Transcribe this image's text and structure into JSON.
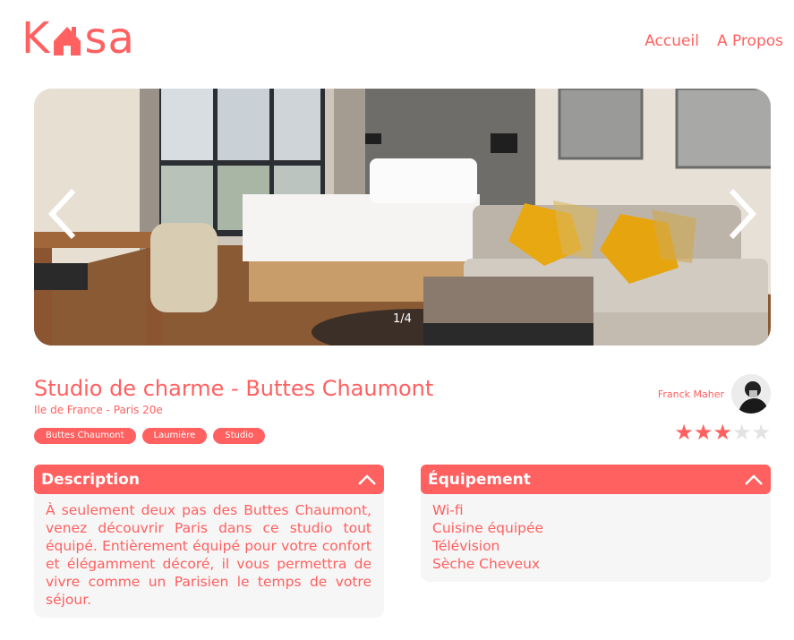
{
  "header": {
    "logo": {
      "text_start": "K",
      "text_end": "sa",
      "icon": "house-icon"
    },
    "nav": [
      {
        "label": "Accueil"
      },
      {
        "label": "A Propos"
      }
    ]
  },
  "carousel": {
    "counter": "1/4",
    "prev_icon": "chevron-left-icon",
    "next_icon": "chevron-right-icon"
  },
  "listing": {
    "title": "Studio de charme - Buttes Chaumont",
    "location": "Ile de France - Paris 20e",
    "tags": [
      "Buttes Chaumont",
      "Laumière",
      "Studio"
    ],
    "host": {
      "name": "Franck Maher",
      "avatar": "avatar-photo"
    },
    "rating": 3,
    "rating_max": 5
  },
  "panels": {
    "description": {
      "title": "Description",
      "text": "À seulement deux pas des Buttes Chaumont, venez découvrir Paris dans ce studio tout équipé. Entièrement équipé pour votre confort et élégamment décoré, il vous permettra de vivre comme un Parisien le temps de votre séjour."
    },
    "equipment": {
      "title": "Équipement",
      "items": [
        "Wi-fi",
        "Cuisine équipée",
        "Télévision",
        "Sèche Cheveux"
      ]
    }
  },
  "colors": {
    "accent": "#ff6060",
    "panel_bg": "#f6f6f6",
    "star_off": "#e3e3e3"
  }
}
